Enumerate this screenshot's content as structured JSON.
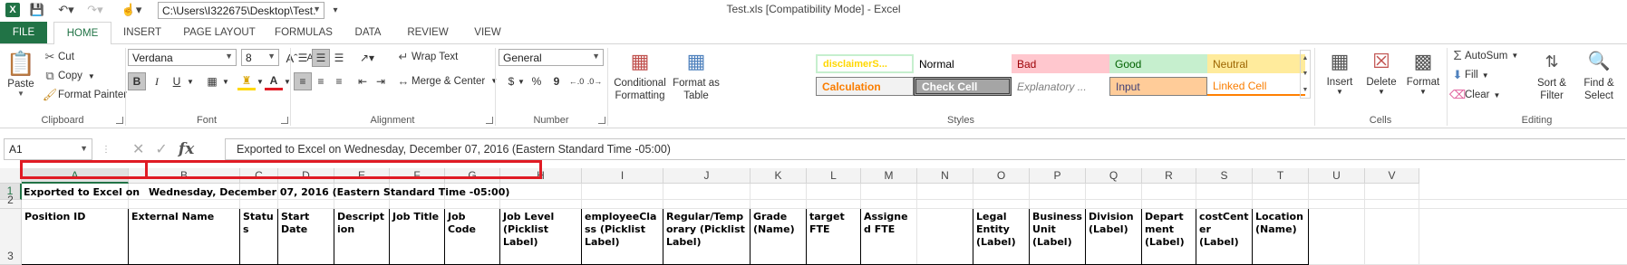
{
  "window": {
    "title": "Test.xls  [Compatibility Mode] - Excel",
    "path": "C:\\Users\\I322675\\Desktop\\Test.",
    "app_icon": "X"
  },
  "tabs": [
    "FILE",
    "HOME",
    "INSERT",
    "PAGE LAYOUT",
    "FORMULAS",
    "DATA",
    "REVIEW",
    "VIEW"
  ],
  "clipboard": {
    "paste": "Paste",
    "cut": "Cut",
    "copy": "Copy",
    "format_painter": "Format Painter",
    "label": "Clipboard"
  },
  "font": {
    "name": "Verdana",
    "size": "8",
    "label": "Font",
    "bold": "B",
    "italic": "I",
    "underline": "U",
    "font_color_letter": "A"
  },
  "alignment": {
    "wrap_text": "Wrap Text",
    "merge_center": "Merge & Center",
    "label": "Alignment"
  },
  "number": {
    "format": "General",
    "currency": "$",
    "percent": "%",
    "comma": "9",
    "label": "Number"
  },
  "styles": {
    "conditional_formatting": [
      "Conditional",
      "Formatting"
    ],
    "format_as_table": [
      "Format as",
      "Table"
    ],
    "label": "Styles",
    "gallery": [
      {
        "name": "disclaimerS...",
        "bg": "#ffffff",
        "color": "#ffd700"
      },
      {
        "name": "Normal",
        "bg": "#ffffff",
        "color": "#000000"
      },
      {
        "name": "Bad",
        "bg": "#ffc7ce",
        "color": "#9c0006"
      },
      {
        "name": "Good",
        "bg": "#c6efce",
        "color": "#006100"
      },
      {
        "name": "Neutral",
        "bg": "#ffeb9c",
        "color": "#9c6500"
      },
      {
        "name": "Calculation",
        "bg": "#f2f2f2",
        "color": "#fa7d00"
      },
      {
        "name": "Check Cell",
        "bg": "#a5a5a5",
        "color": "#ffffff"
      },
      {
        "name": "Explanatory ...",
        "bg": "#ffffff",
        "color": "#7f7f7f"
      },
      {
        "name": "Input",
        "bg": "#ffcc99",
        "color": "#3f3f76"
      },
      {
        "name": "Linked Cell",
        "bg": "#ffffff",
        "color": "#fa7d00"
      }
    ]
  },
  "cells_group": {
    "insert": "Insert",
    "delete": "Delete",
    "format": "Format",
    "label": "Cells"
  },
  "editing": {
    "autosum": "AutoSum",
    "fill": "Fill",
    "clear": "Clear",
    "sort_filter": [
      "Sort &",
      "Filter"
    ],
    "find_select": [
      "Find &",
      "Select"
    ],
    "label": "Editing"
  },
  "formula_bar": {
    "name_box": "A1",
    "fx": "fx",
    "content": "Exported to Excel on Wednesday, December 07, 2016 (Eastern Standard Time -05:00)"
  },
  "sheet": {
    "columns": [
      "A",
      "B",
      "C",
      "D",
      "E",
      "F",
      "G",
      "H",
      "I",
      "J",
      "K",
      "L",
      "M",
      "N",
      "O",
      "P",
      "Q",
      "R",
      "S",
      "T",
      "U",
      "V"
    ],
    "rows": [
      "1",
      "2",
      "3"
    ],
    "a1_text": "Exported to Excel on",
    "b1_text": "Wednesday, December 07, 2016 (Eastern Standard Time -05:00)",
    "headers": [
      "Position ID",
      "External Name",
      "Status",
      "Start Date",
      "Description",
      "Job Title",
      "Job Code",
      "Job Level (Picklist Label)",
      "employeeClass (Picklist Label)",
      "Regular/Temporary (Picklist Label)",
      "Grade (Name)",
      "target FTE",
      "Assigned FTE",
      "",
      "Legal Entity (Label)",
      "Business Unit (Label)",
      "Division (Label)",
      "Department (Label)",
      "costCenter (Label)",
      "Location (Name)"
    ]
  }
}
